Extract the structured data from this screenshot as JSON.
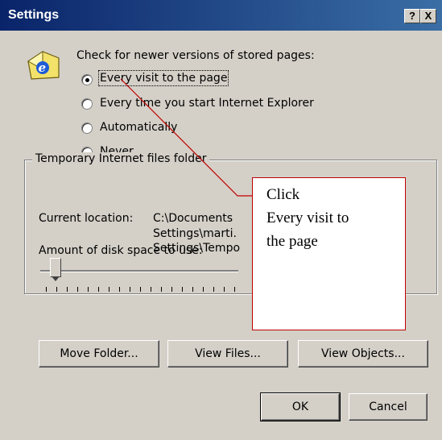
{
  "window": {
    "title": "Settings",
    "help_label": "?",
    "close_label": "X"
  },
  "check": {
    "heading": "Check for newer versions of stored pages:",
    "options": [
      {
        "label": "Every visit to the page",
        "checked": true
      },
      {
        "label": "Every time you start Internet Explorer",
        "checked": false
      },
      {
        "label": "Automatically",
        "checked": false
      },
      {
        "label": "Never",
        "checked": false
      }
    ]
  },
  "temp": {
    "group_label": "Temporary Internet files folder",
    "current_location_label": "Current location:",
    "path_lines": [
      "C:\\Documents",
      "Settings\\marti.",
      "Settings\\Tempo"
    ],
    "disk_space_label": "Amount of disk space to use:",
    "slider_level": 0.05
  },
  "buttons": {
    "move_folder": "Move Folder...",
    "view_files": "View Files...",
    "view_objects": "View Objects...",
    "ok": "OK",
    "cancel": "Cancel"
  },
  "callout": {
    "lines": [
      "Click",
      "Every visit to",
      "the page"
    ],
    "color": "#c00000"
  },
  "colors": {
    "titlebar": "#0a246a",
    "dialog": "#d4d0c8"
  },
  "icons": {
    "app": "internet-explorer-folder-icon"
  }
}
